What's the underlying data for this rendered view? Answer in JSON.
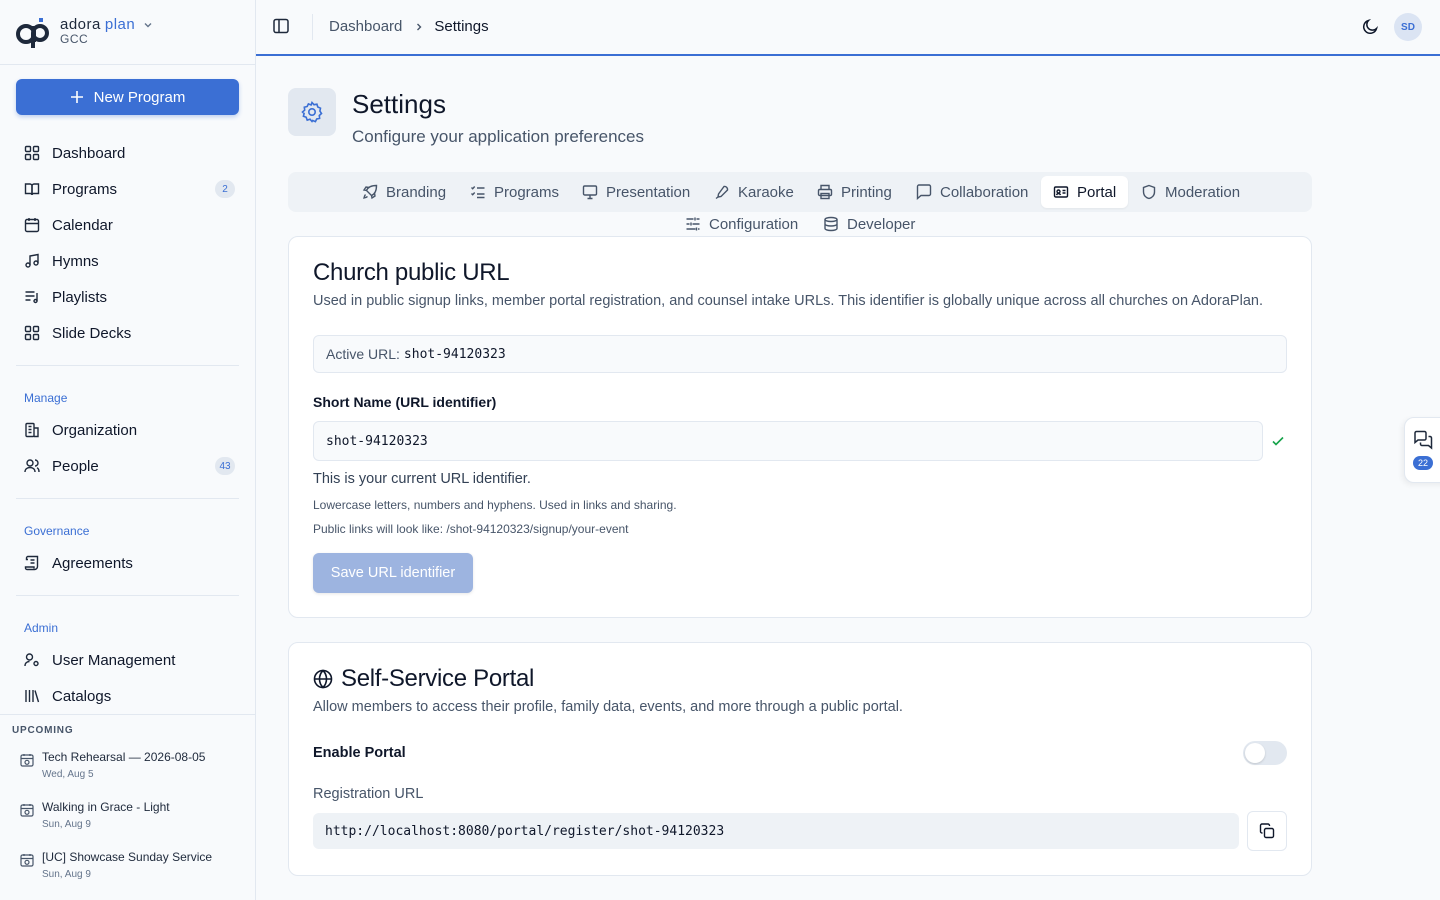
{
  "brand": {
    "name": "adora",
    "name_accent": "plan",
    "org": "GCC"
  },
  "sidebar": {
    "new_program": "New Program",
    "main_items": [
      {
        "label": "Dashboard",
        "icon": "layout-grid-icon"
      },
      {
        "label": "Programs",
        "icon": "book-open-icon",
        "badge": "2"
      },
      {
        "label": "Calendar",
        "icon": "calendar-icon"
      },
      {
        "label": "Hymns",
        "icon": "music-note-icon"
      },
      {
        "label": "Playlists",
        "icon": "list-music-icon"
      },
      {
        "label": "Slide Decks",
        "icon": "layout-grid-icon"
      }
    ],
    "manage_label": "Manage",
    "manage_items": [
      {
        "label": "Organization",
        "icon": "building-icon"
      },
      {
        "label": "People",
        "icon": "users-icon",
        "badge": "43"
      }
    ],
    "governance_label": "Governance",
    "governance_items": [
      {
        "label": "Agreements",
        "icon": "scroll-icon"
      }
    ],
    "admin_label": "Admin",
    "admin_items": [
      {
        "label": "User Management",
        "icon": "user-cog-icon"
      },
      {
        "label": "Catalogs",
        "icon": "library-icon"
      }
    ],
    "upcoming_label": "UPCOMING",
    "upcoming": [
      {
        "title": "Tech Rehearsal — 2026-08-05",
        "date": "Wed, Aug 5"
      },
      {
        "title": "Walking in Grace - Light",
        "date": "Sun, Aug 9"
      },
      {
        "title": "[UC] Showcase Sunday Service",
        "date": "Sun, Aug 9"
      }
    ]
  },
  "topbar": {
    "breadcrumb": [
      "Dashboard",
      "Settings"
    ],
    "avatar": "SD"
  },
  "page": {
    "title": "Settings",
    "subtitle": "Configure your application preferences"
  },
  "tabs": [
    {
      "label": "Branding",
      "icon": "rocket-icon"
    },
    {
      "label": "Programs",
      "icon": "list-checks-icon"
    },
    {
      "label": "Presentation",
      "icon": "monitor-icon"
    },
    {
      "label": "Karaoke",
      "icon": "mic-icon"
    },
    {
      "label": "Printing",
      "icon": "printer-icon"
    },
    {
      "label": "Collaboration",
      "icon": "message-square-icon"
    },
    {
      "label": "Portal",
      "icon": "id-card-icon",
      "active": true
    },
    {
      "label": "Moderation",
      "icon": "shield-icon"
    },
    {
      "label": "Configuration",
      "icon": "sliders-icon"
    },
    {
      "label": "Developer",
      "icon": "database-icon"
    }
  ],
  "public_url": {
    "title": "Church public URL",
    "description": "Used in public signup links, member portal registration, and counsel intake URLs. This identifier is globally unique across all churches on AdoraPlan.",
    "active_label": "Active URL:",
    "active_value": "shot-94120323",
    "field_label": "Short Name (URL identifier)",
    "field_value": "shot-94120323",
    "help_current": "This is your current URL identifier.",
    "help_rules": "Lowercase letters, numbers and hyphens. Used in links and sharing.",
    "help_example": "Public links will look like: /shot-94120323/signup/your-event",
    "save_label": "Save URL identifier"
  },
  "portal": {
    "title": "Self-Service Portal",
    "description": "Allow members to access their profile, family data, events, and more through a public portal.",
    "enable_label": "Enable Portal",
    "enabled": false,
    "registration_label": "Registration URL",
    "registration_url": "http://localhost:8080/portal/register/shot-94120323"
  },
  "chat_widget": {
    "count": "22"
  },
  "colors": {
    "accent": "#3b6fd4",
    "success": "#16a34a"
  }
}
